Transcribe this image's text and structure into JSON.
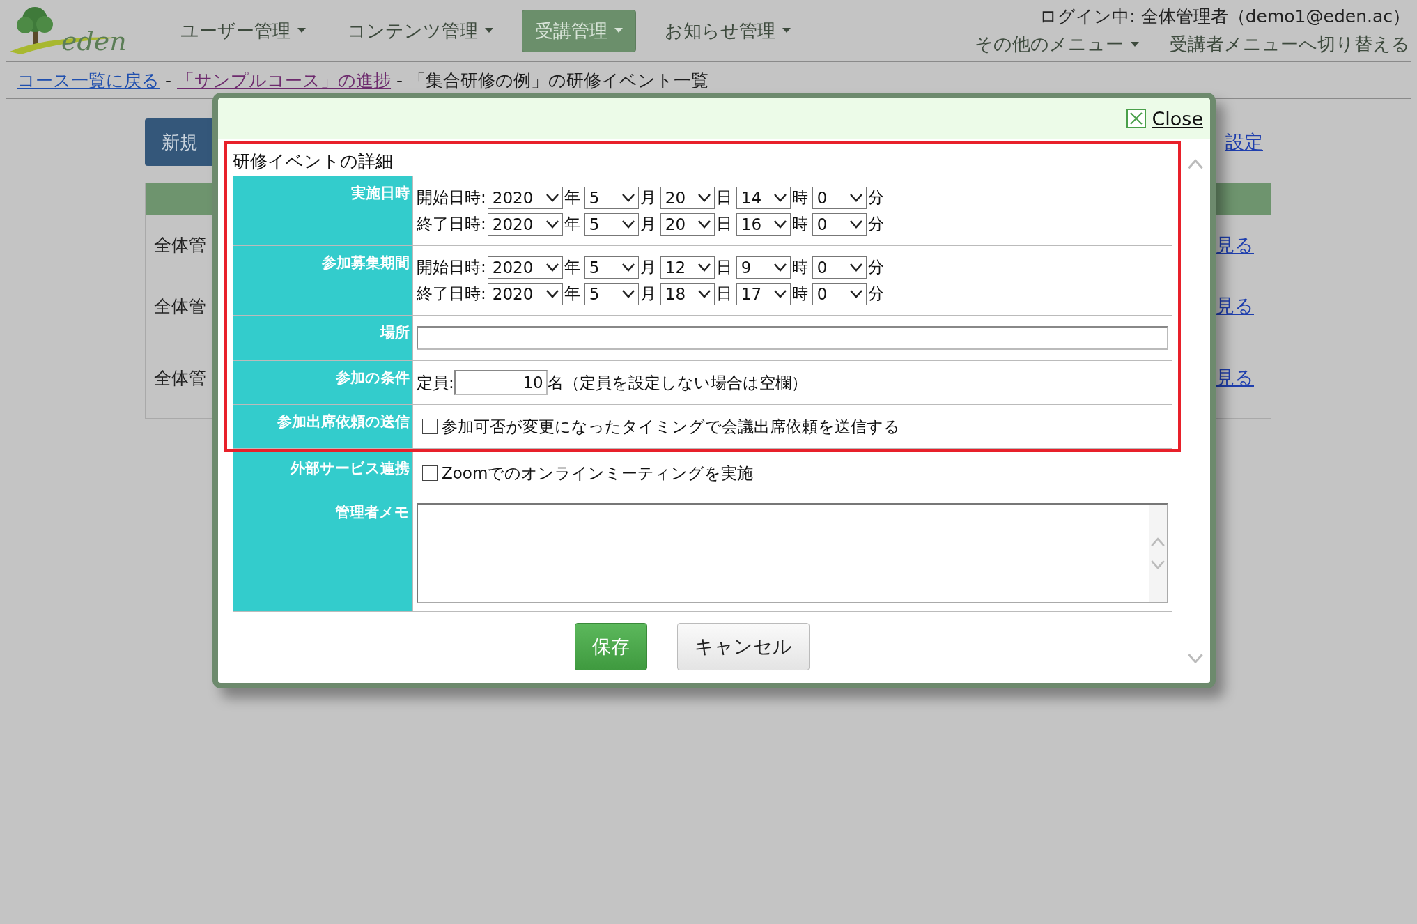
{
  "header": {
    "logo": "eden",
    "nav": [
      {
        "label": "ユーザー管理",
        "selected": false
      },
      {
        "label": "コンテンツ管理",
        "selected": false
      },
      {
        "label": "受講管理",
        "selected": true
      },
      {
        "label": "お知らせ管理",
        "selected": false
      }
    ],
    "login": "ログイン中: 全体管理者（demo1@eden.ac）",
    "other_menu": "その他のメニュー",
    "switch_link": "受講者メニューへ切り替える"
  },
  "breadcrumb": [
    {
      "kind": "link",
      "text": "コース一覧に戻る",
      "visited": false
    },
    {
      "kind": "text",
      "text": "-"
    },
    {
      "kind": "link",
      "text": "「サンプルコース」の進捗",
      "visited": true
    },
    {
      "kind": "text",
      "text": "- 「集合研修の例」の研修イベント一覧"
    }
  ],
  "background": {
    "new_button": "新規",
    "settings_link": "設定",
    "rows": [
      {
        "cell": "全体管",
        "link": "見る"
      },
      {
        "cell": "全体管",
        "link": "見る"
      },
      {
        "cell": "全体管",
        "link": "見る"
      }
    ]
  },
  "modal": {
    "close": "Close",
    "section_title": "研修イベントの詳細",
    "fields": [
      {
        "kind": "datetime",
        "label": "実施日時",
        "highlighted": true,
        "ranges": [
          {
            "label": "開始日時:",
            "parts": [
              {
                "value": "2020",
                "unit": "年"
              },
              {
                "value": "5",
                "unit": "月"
              },
              {
                "value": "20",
                "unit": "日"
              },
              {
                "value": "14",
                "unit": "時"
              },
              {
                "value": "0",
                "unit": "分"
              }
            ]
          },
          {
            "label": "終了日時:",
            "parts": [
              {
                "value": "2020",
                "unit": "年"
              },
              {
                "value": "5",
                "unit": "月"
              },
              {
                "value": "20",
                "unit": "日"
              },
              {
                "value": "16",
                "unit": "時"
              },
              {
                "value": "0",
                "unit": "分"
              }
            ]
          }
        ]
      },
      {
        "kind": "datetime",
        "label": "参加募集期間",
        "highlighted": true,
        "ranges": [
          {
            "label": "開始日時:",
            "parts": [
              {
                "value": "2020",
                "unit": "年"
              },
              {
                "value": "5",
                "unit": "月"
              },
              {
                "value": "12",
                "unit": "日"
              },
              {
                "value": "9",
                "unit": "時"
              },
              {
                "value": "0",
                "unit": "分"
              }
            ]
          },
          {
            "label": "終了日時:",
            "parts": [
              {
                "value": "2020",
                "unit": "年"
              },
              {
                "value": "5",
                "unit": "月"
              },
              {
                "value": "18",
                "unit": "日"
              },
              {
                "value": "17",
                "unit": "時"
              },
              {
                "value": "0",
                "unit": "分"
              }
            ]
          }
        ]
      },
      {
        "kind": "text",
        "label": "場所",
        "highlighted": true
      },
      {
        "kind": "number",
        "label": "参加の条件",
        "highlighted": true,
        "prefix": "定員:",
        "value": "10",
        "suffix": "名（定員を設定しない場合は空欄）"
      },
      {
        "kind": "checkbox",
        "label": "参加出席依頼の送信",
        "highlighted": true,
        "text": "参加可否が変更になったタイミングで会議出席依頼を送信する",
        "checked": false
      },
      {
        "kind": "checkbox",
        "label": "外部サービス連携",
        "highlighted": false,
        "text": "Zoomでのオンラインミーティングを実施",
        "checked": false
      },
      {
        "kind": "textarea",
        "label": "管理者メモ",
        "highlighted": false
      }
    ],
    "buttons": [
      {
        "kind": "primary",
        "label": "保存"
      },
      {
        "kind": "default",
        "label": "キャンセル"
      }
    ]
  }
}
